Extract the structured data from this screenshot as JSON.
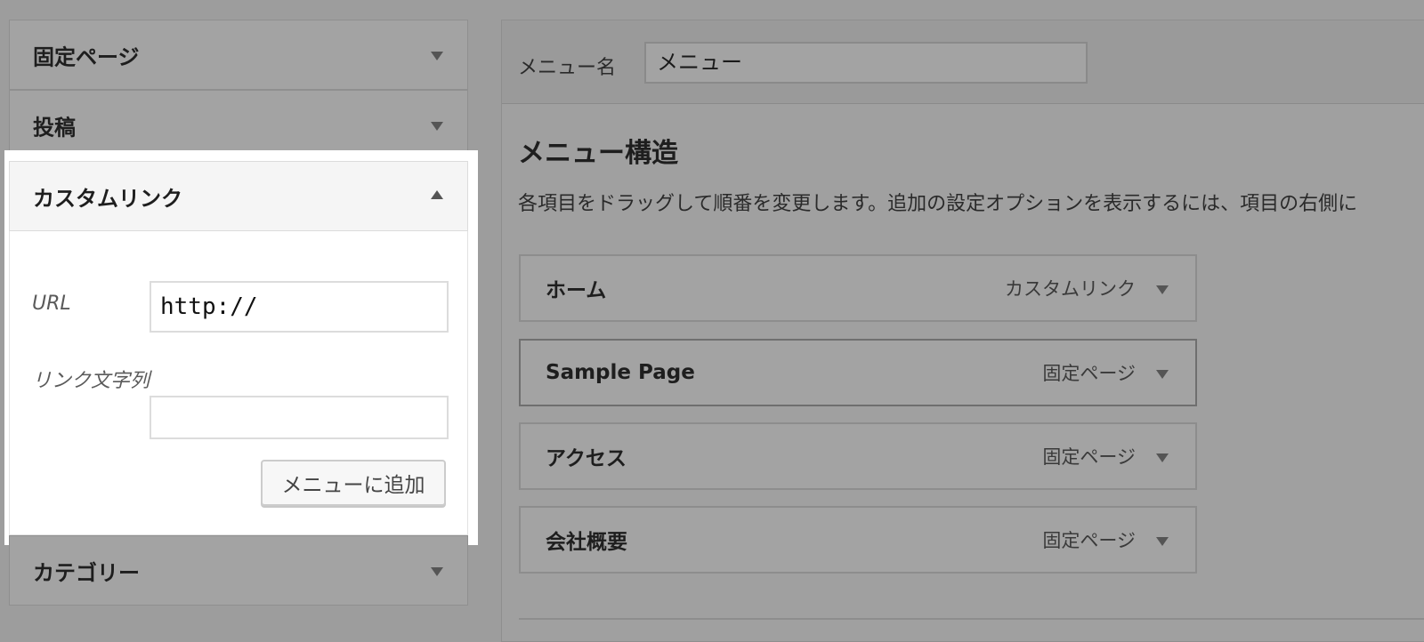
{
  "sidebar": {
    "sections": [
      {
        "title": "固定ページ",
        "expanded": false
      },
      {
        "title": "投稿",
        "expanded": false
      },
      {
        "title": "カスタムリンク",
        "expanded": true
      },
      {
        "title": "カテゴリー",
        "expanded": false
      }
    ],
    "custom_link": {
      "url_label": "URL",
      "url_value": "http://",
      "link_text_label": "リンク文字列",
      "link_text_value": "",
      "add_button": "メニューに追加"
    }
  },
  "main": {
    "menu_name_label": "メニュー名",
    "menu_name_value": "メニュー",
    "structure_title": "メニュー構造",
    "structure_desc": "各項目をドラッグして順番を変更します。追加の設定オプションを表示するには、項目の右側に",
    "items": [
      {
        "title": "ホーム",
        "type": "カスタムリンク"
      },
      {
        "title": "Sample Page",
        "type": "固定ページ"
      },
      {
        "title": "アクセス",
        "type": "固定ページ"
      },
      {
        "title": "会社概要",
        "type": "固定ページ"
      }
    ]
  },
  "colors": {
    "overlay_gray": "#9d9d9d",
    "highlight": "#ffffff",
    "text": "#1e1e1e"
  }
}
